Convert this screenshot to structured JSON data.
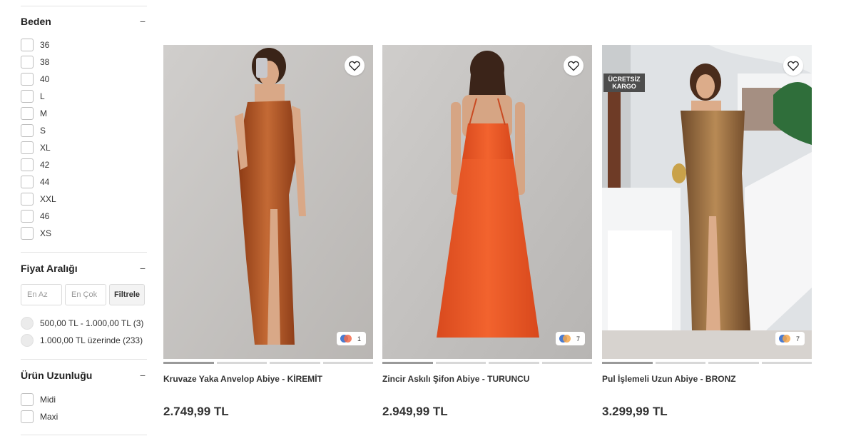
{
  "filters": {
    "size": {
      "title": "Beden",
      "collapse": "−",
      "options": [
        "36",
        "38",
        "40",
        "L",
        "M",
        "S",
        "XL",
        "42",
        "44",
        "XXL",
        "46",
        "XS"
      ]
    },
    "price": {
      "title": "Fiyat Aralığı",
      "collapse": "−",
      "min_placeholder": "En Az",
      "max_placeholder": "En Çok",
      "button": "Filtrele",
      "ranges": [
        "500,00 TL - 1.000,00 TL (3)",
        "1.000,00 TL üzerinde (233)"
      ]
    },
    "length": {
      "title": "Ürün Uzunluğu",
      "collapse": "−",
      "options": [
        "Midi",
        "Maxi"
      ]
    }
  },
  "products": [
    {
      "name": "Kruvaze Yaka Anvelop Abiye - KİREMİT",
      "price": "2.749,99 TL",
      "color_count": "1",
      "badge": "",
      "dress_color": "#b5541f"
    },
    {
      "name": "Zincir Askılı Şifon Abiye - TURUNCU",
      "price": "2.949,99 TL",
      "color_count": "7",
      "badge": "",
      "dress_color": "#f05a28"
    },
    {
      "name": "Pul İşlemeli Uzun Abiye - BRONZ",
      "price": "3.299,99 TL",
      "color_count": "7",
      "badge": "ÜCRETSİZ KARGO",
      "dress_color": "#a0703c"
    }
  ]
}
